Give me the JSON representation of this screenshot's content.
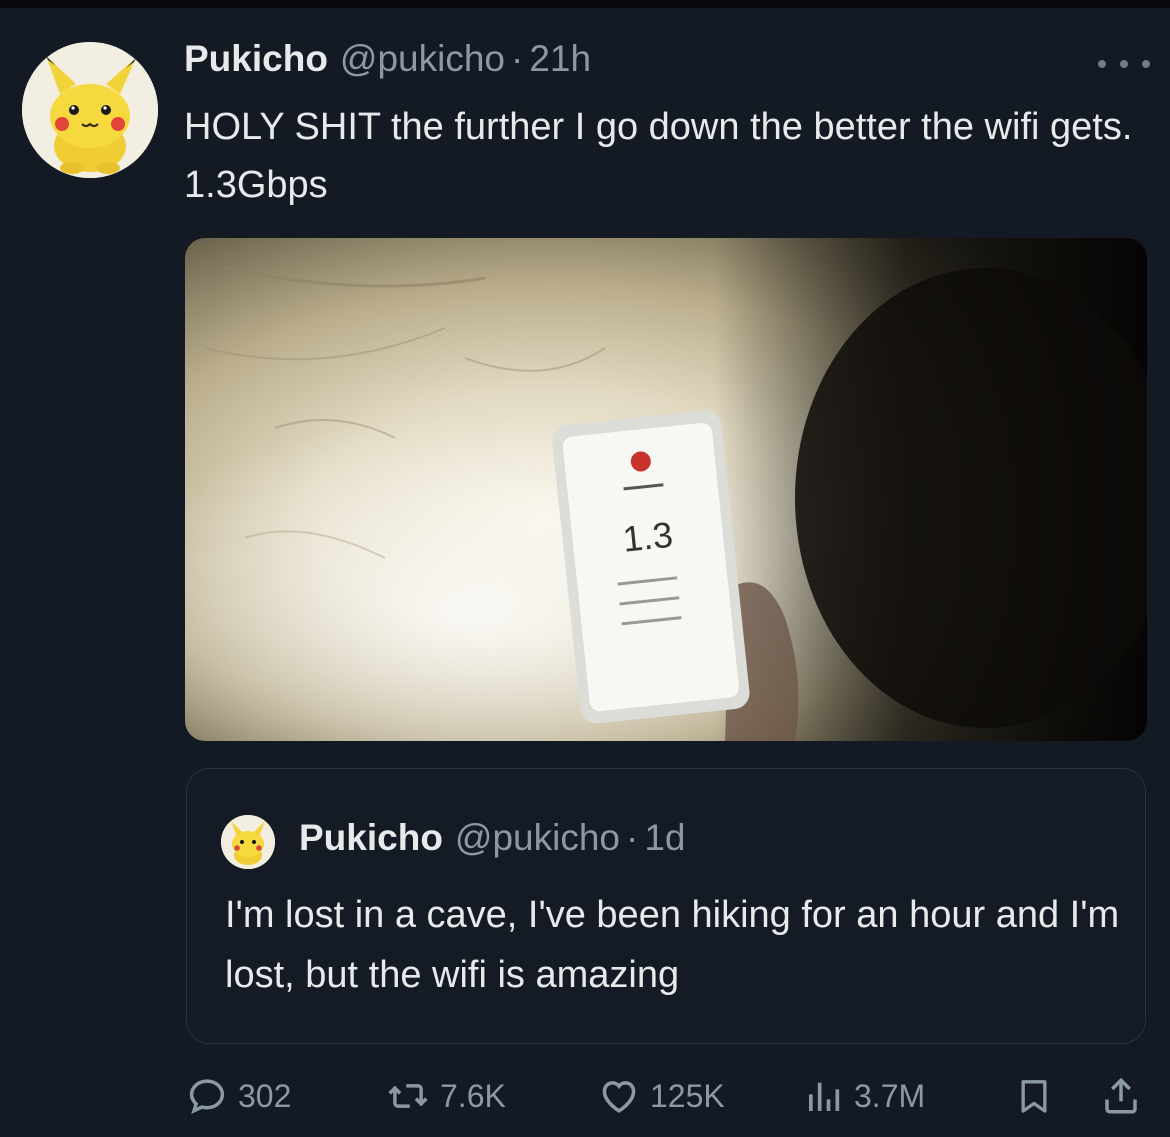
{
  "tweet": {
    "author_name": "Pukicho",
    "author_handle": "@pukicho",
    "separator": "·",
    "time": "21h",
    "text": "HOLY SHIT the further I go down the better the wifi gets. 1.3Gbps",
    "avatar_icon": "pikachu-plush-avatar",
    "more_icon": "more-dots-icon",
    "media": {
      "phone_screen_text": "1.3"
    }
  },
  "quoted_tweet": {
    "author_name": "Pukicho",
    "author_handle": "@pukicho",
    "separator": "·",
    "time": "1d",
    "text": "I'm lost in a cave, I've been hiking for an hour and I'm lost, but the wifi is amazing"
  },
  "actions": {
    "replies": "302",
    "retweets": "7.6K",
    "likes": "125K",
    "views": "3.7M"
  },
  "colors": {
    "background": "#141a24",
    "text": "#e7e9ea",
    "muted": "#8b98a5",
    "border": "#2a323d"
  }
}
